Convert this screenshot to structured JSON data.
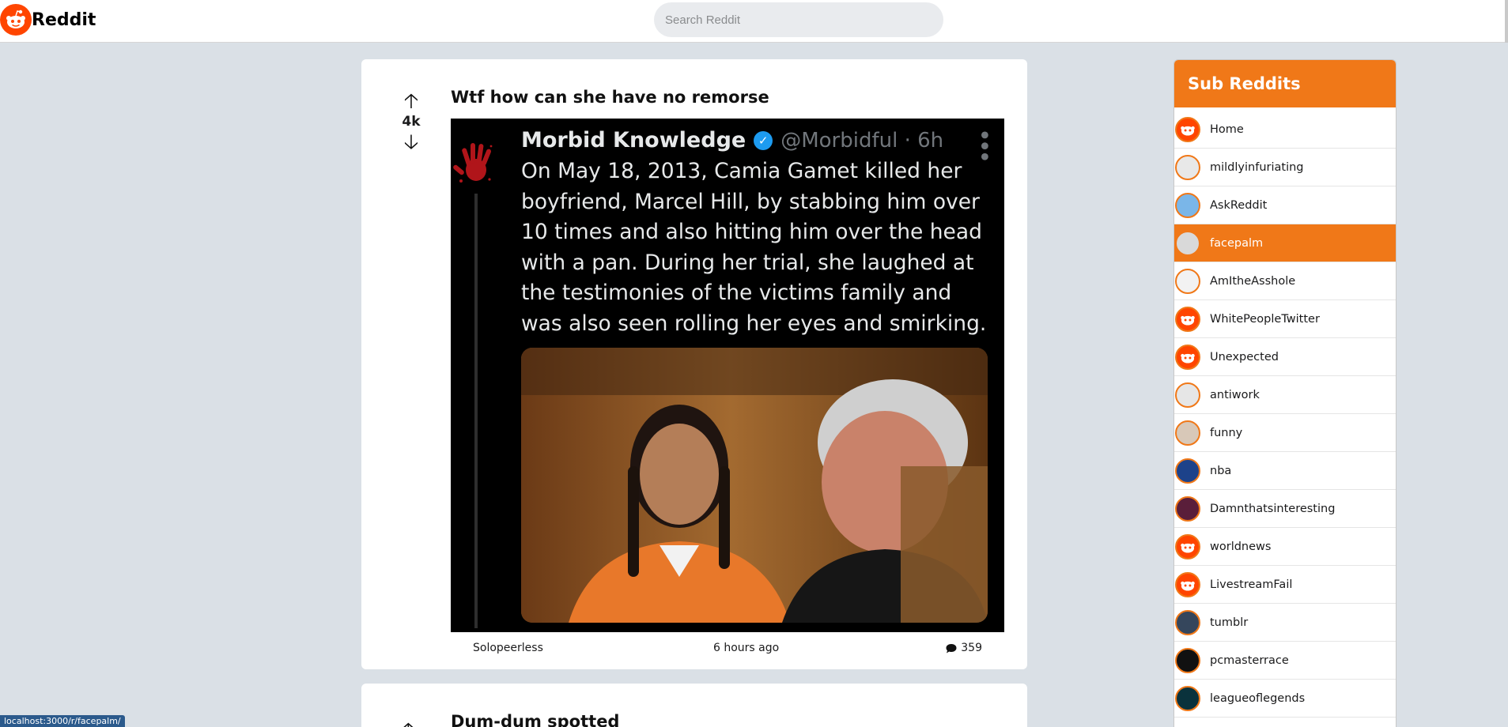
{
  "header": {
    "logo_text": "Reddit",
    "search_placeholder": "Search Reddit"
  },
  "post": {
    "title": "Wtf how can she have no remorse",
    "votes": "4k",
    "author": "Solopeerless",
    "time": "6 hours ago",
    "comments": "359",
    "tweet": {
      "name": "Morbid Knowledge",
      "handle": "@Morbidful · 6h",
      "text": "On May 18, 2013, Camia Gamet killed her boyfriend, Marcel Hill, by stabbing him over 10 times and also hitting him over the head with a pan. During her trial, she laughed at the testimonies of the victims family and was also seen rolling her eyes and smirking."
    }
  },
  "post2": {
    "title": "Dum-dum spotted"
  },
  "sidebar": {
    "title": "Sub Reddits",
    "items": [
      {
        "label": "Home",
        "icon": "reddit-snoo-icon",
        "color": "#ff4500"
      },
      {
        "label": "mildlyinfuriating",
        "icon": "mildlyinfuriating-icon",
        "color": "#e8e8e8"
      },
      {
        "label": "AskReddit",
        "icon": "askreddit-icon",
        "color": "#7ab6e8"
      },
      {
        "label": "facepalm",
        "icon": "facepalm-icon",
        "color": "#d9d9d9"
      },
      {
        "label": "AmItheAsshole",
        "icon": "amitheasshole-icon",
        "color": "#f2f2f2"
      },
      {
        "label": "WhitePeopleTwitter",
        "icon": "reddit-snoo-icon",
        "color": "#ff4500"
      },
      {
        "label": "Unexpected",
        "icon": "reddit-snoo-icon",
        "color": "#ff4500"
      },
      {
        "label": "antiwork",
        "icon": "antiwork-icon",
        "color": "#e6e6e6"
      },
      {
        "label": "funny",
        "icon": "funny-icon",
        "color": "#d8c8b8"
      },
      {
        "label": "nba",
        "icon": "nba-icon",
        "color": "#1d428a"
      },
      {
        "label": "Damnthatsinteresting",
        "icon": "damnthatsinteresting-icon",
        "color": "#5a1e3a"
      },
      {
        "label": "worldnews",
        "icon": "reddit-snoo-icon",
        "color": "#ff4500"
      },
      {
        "label": "LivestreamFail",
        "icon": "reddit-snoo-icon",
        "color": "#ff4500"
      },
      {
        "label": "tumblr",
        "icon": "tumblr-icon",
        "color": "#35465c"
      },
      {
        "label": "pcmasterrace",
        "icon": "pcmasterrace-icon",
        "color": "#111111"
      },
      {
        "label": "leagueoflegends",
        "icon": "leagueoflegends-icon",
        "color": "#0a323c"
      }
    ],
    "active_index": 3
  },
  "status_bar": {
    "url": "localhost:3000/r/facepalm/"
  },
  "colors": {
    "accent": "#f07818",
    "background": "#dae0e6",
    "reddit_orange": "#ff4500"
  }
}
